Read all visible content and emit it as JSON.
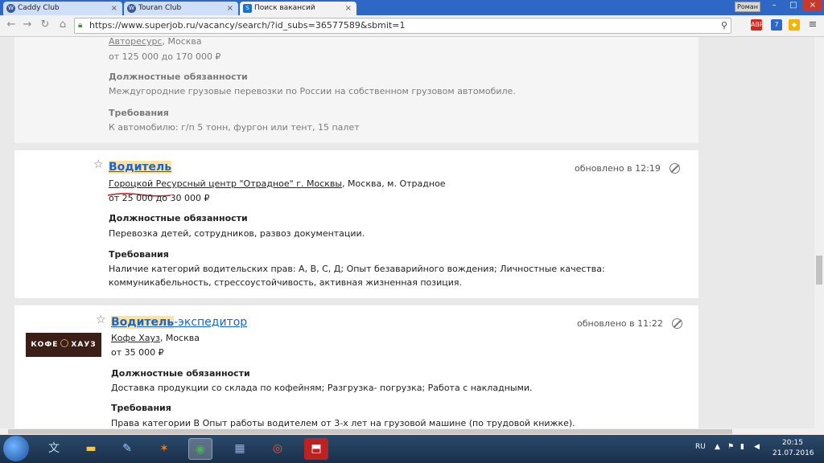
{
  "browser": {
    "tabs": [
      {
        "label": "Caddy Club",
        "active": false
      },
      {
        "label": "Touran Club",
        "active": false
      },
      {
        "label": "Поиск вакансий",
        "active": true
      }
    ],
    "profile": "Роман",
    "url": "https://www.superjob.ru/vacancy/search/?id_subs=36577589&sbmit=1",
    "extensions": [
      {
        "name": "adblock-icon",
        "label": "ABP",
        "color": "#d9261c"
      },
      {
        "name": "badge-icon",
        "label": "7",
        "color": "#2f67c6"
      },
      {
        "name": "menu-icon",
        "label": "≡",
        "color": "#666666"
      }
    ]
  },
  "vacancies": [
    {
      "company": "Авторесурс",
      "location": ", Москва",
      "salary": "от 125 000 до 170 000 ₽",
      "duties_heading": "Должностные обязанности",
      "duties": "Междугородние грузовые перевозки по России на собственном грузовом автомобиле.",
      "req_heading": "Требования",
      "requirements": "К автомобилю: г/п 5 тонн, фургон или тент, 15 палет"
    },
    {
      "title_hl": "Водитель",
      "title_rest": "",
      "updated": "обновлено в 12:19",
      "company": "Гороцкой Ресурсный центр \"Отрадное\" г. Москвы",
      "location": ", Москва, м. Отрадное",
      "salary": "от 25 000 до 30 000 ₽",
      "duties_heading": "Должностные обязанности",
      "duties": "Перевозка детей, сотрудников, развоз документации.",
      "req_heading": "Требования",
      "requirements_line1": "Наличие категорий водительских прав: А, В, С, Д; Опыт безаварийного вождения; Личностные качества:",
      "requirements_line2": "коммуникабельность, стрессоустойчивость, активная жизненная позиция."
    },
    {
      "title_hl": "Водитель",
      "title_rest": "-экспедитор",
      "updated": "обновлено в 11:22",
      "logo": "КОФЕ ХАУЗ",
      "company": "Кофе Хауз",
      "location": ", Москва",
      "salary": "от 35 000 ₽",
      "duties_heading": "Должностные обязанности",
      "duties": "Доставка продукции со склада по кофейням; Разгрузка- погрузка; Работа с накладными.",
      "req_heading": "Требования",
      "requirements": "Права категории В Опыт работы водителем от 3-х лет на грузовой машине (по трудовой книжке)."
    }
  ],
  "taskbar": {
    "language": "RU",
    "time": "20:15",
    "date": "21.07.2016"
  }
}
